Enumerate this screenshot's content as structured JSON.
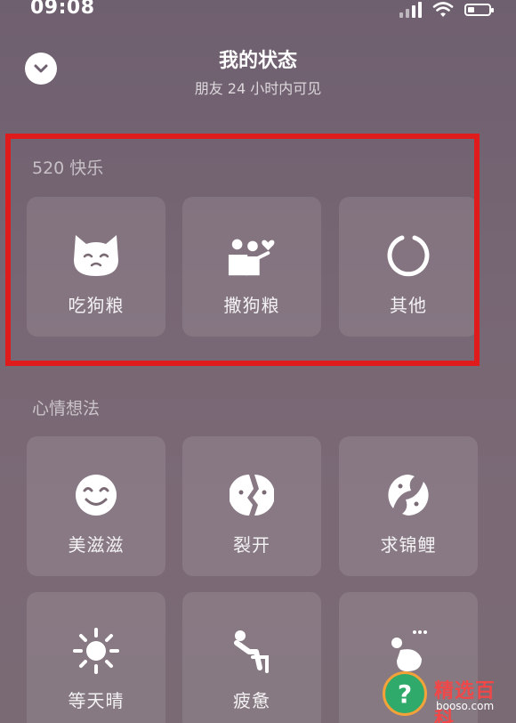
{
  "status_bar": {
    "time": "09:08",
    "battery_level": 0.3
  },
  "header": {
    "title": "我的状态",
    "subtitle": "朋友 24 小时内可见",
    "collapse_icon": "chevron-down-icon"
  },
  "sections": [
    {
      "title": "520 快乐",
      "items": [
        {
          "label": "吃狗粮",
          "icon": "cat-face-icon"
        },
        {
          "label": "撒狗粮",
          "icon": "couple-heart-icon"
        },
        {
          "label": "其他",
          "icon": "ring-icon"
        }
      ]
    },
    {
      "title": "心情想法",
      "items": [
        {
          "label": "美滋滋",
          "icon": "smile-icon"
        },
        {
          "label": "裂开",
          "icon": "cracked-face-icon"
        },
        {
          "label": "求锦鲤",
          "icon": "koi-icon"
        },
        {
          "label": "等天晴",
          "icon": "sun-icon"
        },
        {
          "label": "疲惫",
          "icon": "slouching-person-icon"
        },
        {
          "label": "",
          "icon": "sitting-person-icon"
        }
      ]
    }
  ],
  "colors": {
    "highlight": "#e01b1b",
    "background": "#776673"
  },
  "watermark": {
    "brand": "精选百科",
    "url": "booso.com",
    "glyph": "?"
  }
}
